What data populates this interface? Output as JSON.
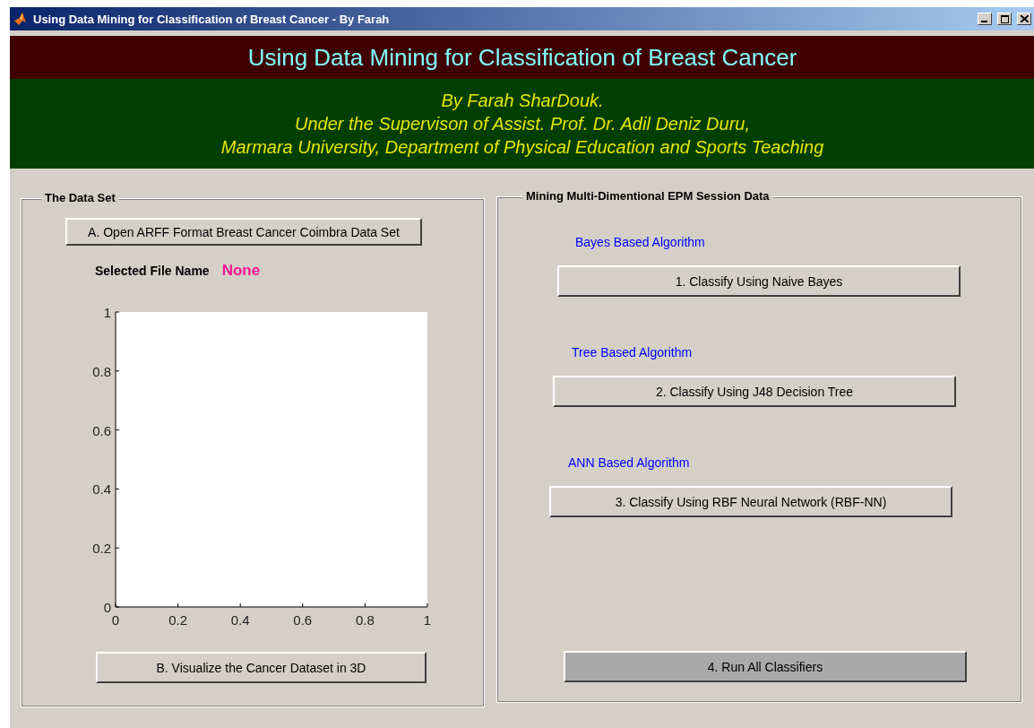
{
  "window": {
    "title": "Using Data Mining for Classification of Breast Cancer - By Farah"
  },
  "header": {
    "title": "Using Data Mining for Classification of Breast Cancer",
    "lines": [
      "By Farah SharDouk.",
      "Under the Supervison of Assist. Prof. Dr. Adil Deniz Duru,",
      "Marmara University, Department of Physical Education and Sports Teaching"
    ]
  },
  "data_panel": {
    "title": "The Data Set",
    "open_button": "A. Open ARFF Format Breast Cancer Coimbra Data Set",
    "file_label": "Selected File Name",
    "file_value": "None",
    "chart_data": {
      "type": "line",
      "xlim": [
        0,
        1
      ],
      "ylim": [
        0,
        1
      ],
      "xticks": [
        {
          "value": 0,
          "label": "0"
        },
        {
          "value": 0.2,
          "label": "0.2"
        },
        {
          "value": 0.4,
          "label": "0.4"
        },
        {
          "value": 0.6,
          "label": "0.6"
        },
        {
          "value": 0.8,
          "label": "0.8"
        },
        {
          "value": 1,
          "label": "1"
        }
      ],
      "yticks": [
        {
          "value": 0,
          "label": "0"
        },
        {
          "value": 0.2,
          "label": "0.2"
        },
        {
          "value": 0.4,
          "label": "0.4"
        },
        {
          "value": 0.6,
          "label": "0.6"
        },
        {
          "value": 0.8,
          "label": "0.8"
        },
        {
          "value": 1,
          "label": "1"
        }
      ]
    },
    "visualize_button": "B. Visualize the Cancer  Dataset in 3D"
  },
  "mining_panel": {
    "title": "Mining Multi-Dimentional EPM Session Data",
    "groups": [
      {
        "label": "Bayes Based Algorithm",
        "button": "1. Classify Using Naive Bayes"
      },
      {
        "label": "Tree Based Algorithm",
        "button": "2. Classify Using J48 Decision Tree"
      },
      {
        "label": "ANN Based Algorithm",
        "button": "3. Classify Using RBF Neural Network (RBF-NN)"
      }
    ],
    "run_button": {
      "label": "4. Run All Classifiers",
      "kind": "dark"
    }
  }
}
